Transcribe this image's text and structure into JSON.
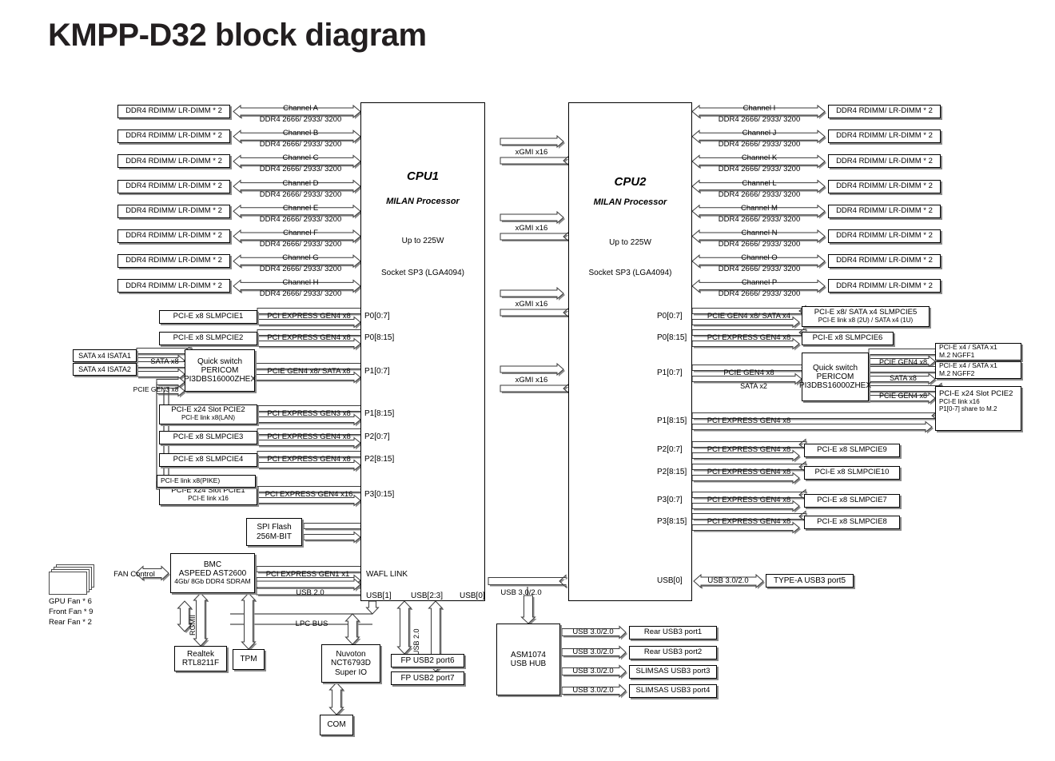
{
  "page": {
    "title": "KMPP-D32 block diagram"
  },
  "cpu1": {
    "name": "CPU1",
    "processor": "MILAN Processor",
    "power": "Up to 225W",
    "socket": "Socket SP3 (LGA4094)",
    "wafl": "WAFL LINK",
    "usb_ports": [
      "USB[1]",
      "USB[2:3]",
      "USB[0]"
    ],
    "pcie_ports": [
      "P0[0:7]",
      "P0[8:15]",
      "P1[0:7]",
      "P1[8:15]",
      "P2[0:7]",
      "P2[8:15]",
      "P3[0:15]"
    ]
  },
  "cpu2": {
    "name": "CPU2",
    "processor": "MILAN Processor",
    "power": "Up to 225W",
    "socket": "Socket SP3 (LGA4094)",
    "pcie_ports": [
      "P0[0:7]",
      "P0[8:15]",
      "P1[0:7]",
      "P1[8:15]",
      "P2[0:7]",
      "P2[8:15]",
      "P3[0:7]",
      "P3[8:15]"
    ],
    "usb_port": "USB[0]"
  },
  "xgmi": {
    "label": "xGMI x16",
    "count": 4
  },
  "memory": {
    "dimm_label": "DDR4 RDIMM/ LR-DIMM * 2",
    "speed_label": "DDR4 2666/ 2933/ 3200",
    "left_channels": [
      "Channel A",
      "Channel B",
      "Channel C",
      "Channel D",
      "Channel E",
      "Channel F",
      "Channel G",
      "Channel H"
    ],
    "right_channels": [
      "Channel I",
      "Channel J",
      "Channel K",
      "Channel L",
      "Channel M",
      "Channel N",
      "Channel O",
      "Channel P"
    ]
  },
  "cpu1_io": {
    "rows": [
      {
        "port": "P0[0:7]",
        "bus": "PCI EXPRESS GEN4 x8",
        "device": "PCI-E x8 SLMPCIE1",
        "device_sub": ""
      },
      {
        "port": "P0[8:15]",
        "bus": "PCI EXPRESS GEN4 x8",
        "device": "PCI-E x8 SLMPCIE2",
        "device_sub": ""
      },
      {
        "port": "P1[0:7]",
        "bus": "PCIE GEN4 x8/ SATA x8",
        "device": "Quick switch",
        "device_sub": ""
      },
      {
        "port": "P1[8:15]",
        "bus": "PCI EXPRESS GEN3 x8",
        "device": "PCI-E x24 Slot PCIE2",
        "device_sub": "PCI-E link x8(LAN)"
      },
      {
        "port": "P2[0:7]",
        "bus": "PCI EXPRESS GEN4 x8",
        "device": "PCI-E x8 SLMPCIE3",
        "device_sub": ""
      },
      {
        "port": "P2[8:15]",
        "bus": "PCI EXPRESS GEN4 x8",
        "device": "PCI-E x8 SLMPCIE4",
        "device_sub": ""
      },
      {
        "port": "P3[0:15]",
        "bus": "PCI EXPRESS GEN4 x16",
        "device": "PCI-E x24 Slot PCIE1",
        "device_sub": "PCI-E link x16"
      }
    ],
    "quick_switch": {
      "l1": "Quick switch",
      "l2": "PERICOM",
      "l3": "PI3DBS16000ZHEX"
    },
    "sata1": "SATA x4 ISATA1",
    "sata2": "SATA x4 ISATA2",
    "sata_bus": "SATA x8",
    "pcie_gen3_bus": "PCIE GEN3 x8",
    "pike": "PCI-E link x8(PIKE)"
  },
  "cpu2_io": {
    "rows": [
      {
        "port": "P0[0:7]",
        "bus": "PCIE GEN4 x8/ SATA x4",
        "device": "PCI-E x8/ SATA x4 SLMPCIE5",
        "device_sub": "PCI-E link x8 (2U) / SATA x4 (1U)"
      },
      {
        "port": "P0[8:15]",
        "bus": "PCI EXPRESS GEN4 x8",
        "device": "PCI-E x8 SLMPCIE6",
        "device_sub": ""
      },
      {
        "port": "P1[0:7]",
        "bus": "PCIE GEN4 x8",
        "device": "Quick switch",
        "device_sub": "SATA x2"
      },
      {
        "port": "P1[8:15]",
        "bus": "PCI EXPRESS GEN4 x8",
        "device": "",
        "device_sub": ""
      },
      {
        "port": "P2[0:7]",
        "bus": "PCI EXPRESS GEN4 x8",
        "device": "PCI-E x8 SLMPCIE9",
        "device_sub": ""
      },
      {
        "port": "P2[8:15]",
        "bus": "PCI EXPRESS GEN4 x8",
        "device": "PCI-E x8 SLMPCIE10",
        "device_sub": ""
      },
      {
        "port": "P3[0:7]",
        "bus": "PCI EXPRESS GEN4 x8",
        "device": "PCI-E x8 SLMPCIE7",
        "device_sub": ""
      },
      {
        "port": "P3[8:15]",
        "bus": "PCI EXPRESS GEN4 x8",
        "device": "PCI-E x8 SLMPCIE8",
        "device_sub": ""
      }
    ],
    "quick_switch": {
      "l1": "Quick switch",
      "l2": "PERICOM",
      "l3": "PI3DBS16000ZHEX"
    },
    "sata_x2": "SATA x2",
    "sw_out_top": "PCIE GEN4 x8",
    "sw_out_sata": "SATA x8",
    "sw_out_bot": "PCIE GEN4 x8",
    "m2_1": {
      "l1": "PCI-E x4 / SATA x1",
      "l2": "M.2 NGFF1"
    },
    "m2_2": {
      "l1": "PCI-E x4 / SATA x1",
      "l2": "M.2 NGFF2"
    },
    "pcie2_slot": {
      "l1": "PCI-E x24 Slot PCIE2",
      "l2": "PCI-E link x16",
      "l3": "P1[0-7] share to M.2"
    },
    "usb_bus": "USB 3.0/2.0",
    "usb_device": "TYPE-A USB3 port5"
  },
  "bmc": {
    "l1": "BMC",
    "l2": "ASPEED AST2600",
    "l3": "4Gb/ 8Gb DDR4 SDRAM",
    "fan_control": "FAN Control",
    "fan_notes": [
      "GPU Fan * 6",
      "Front Fan * 9",
      "Rear Fan * 2"
    ],
    "pcie_bus": "PCI EXPRESS GEN1 x1",
    "usb_bus": "USB 2.0",
    "rgmii": "RGMII",
    "lpc_bus": "LPC BUS"
  },
  "spi_flash": {
    "l1": "SPI Flash",
    "l2": "256M-BIT"
  },
  "realtek": {
    "l1": "Realtek",
    "l2": "RTL8211F"
  },
  "tpm": {
    "l1": "TPM"
  },
  "superio": {
    "l1": "Nuvoton",
    "l2": "NCT6793D",
    "l3": "Super IO"
  },
  "com": {
    "l1": "COM"
  },
  "fp_usb": {
    "bus": "USB 2.0",
    "ports": [
      "FP USB2 port6",
      "FP USB2 port7"
    ]
  },
  "usb_hub": {
    "l1": "ASM1074",
    "l2": "USB HUB",
    "in_bus": "USB 3.0/2.0",
    "out_bus": "USB 3.0/2.0",
    "ports": [
      "Rear USB3 port1",
      "Rear USB3 port2",
      "SLIMSAS USB3 port3",
      "SLIMSAS USB3 port4"
    ]
  }
}
